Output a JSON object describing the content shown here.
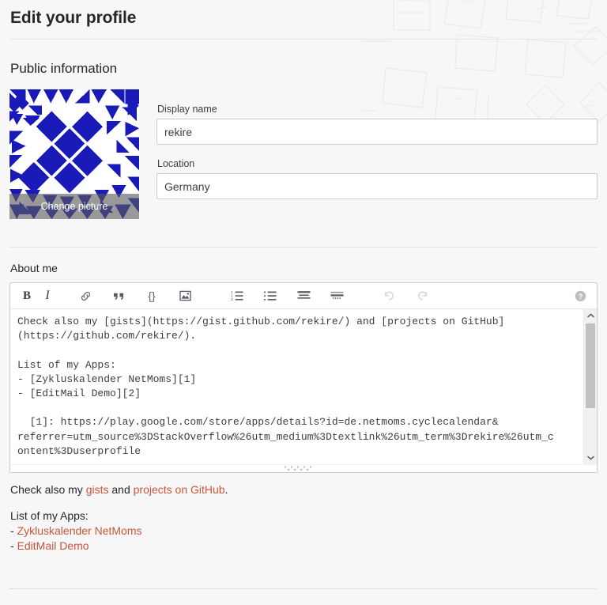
{
  "page": {
    "title": "Edit your profile",
    "section_title": "Public information"
  },
  "avatar": {
    "name": "identicon-avatar",
    "change_label": "Change picture",
    "color": "#1a1ab8",
    "background": "#ffffff"
  },
  "fields": {
    "display_name": {
      "label": "Display name",
      "value": "rekire",
      "placeholder": "Display name"
    },
    "location": {
      "label": "Location",
      "value": "Germany",
      "placeholder": "Location"
    }
  },
  "about": {
    "label": "About me",
    "toolbar": [
      {
        "name": "bold-icon",
        "label": "B",
        "title": "Bold",
        "state": "enabled"
      },
      {
        "name": "italic-icon",
        "label": "I",
        "title": "Italic",
        "state": "enabled"
      },
      {
        "name": "link-icon",
        "label": "",
        "title": "Hyperlink",
        "state": "enabled"
      },
      {
        "name": "quote-icon",
        "label": "“",
        "title": "Blockquote",
        "state": "enabled"
      },
      {
        "name": "code-icon",
        "label": "{}",
        "title": "Code Sample",
        "state": "enabled"
      },
      {
        "name": "image-icon",
        "label": "",
        "title": "Image",
        "state": "enabled"
      },
      {
        "name": "ordered-list-icon",
        "label": "",
        "title": "Numbered List",
        "state": "enabled"
      },
      {
        "name": "bulleted-list-icon",
        "label": "",
        "title": "Bulleted List",
        "state": "enabled"
      },
      {
        "name": "heading-icon",
        "label": "",
        "title": "Heading",
        "state": "enabled"
      },
      {
        "name": "horizontal-rule-icon",
        "label": "",
        "title": "Horizontal Rule",
        "state": "enabled"
      },
      {
        "name": "undo-icon",
        "label": "",
        "title": "Undo",
        "state": "disabled"
      },
      {
        "name": "redo-icon",
        "label": "",
        "title": "Redo",
        "state": "disabled"
      },
      {
        "name": "help-icon",
        "label": "?",
        "title": "Help",
        "state": "enabled"
      }
    ],
    "textarea_value": "Check also my [gists](https://gist.github.com/rekire/) and [projects on GitHub]\n(https://github.com/rekire/).\n\nList of my Apps:\n- [Zykluskalender NetMoms][1]\n- [EditMail Demo][2]\n\n  [1]: https://play.google.com/store/apps/details?id=de.netmoms.cyclecalendar&\nreferrer=utm_source%3DStackOverflow%26utm_medium%3Dtextlink%26utm_term%3Drekire%26utm_c\nontent%3Duserprofile",
    "textarea_placeholder": ""
  },
  "preview": {
    "line1_prefix": "Check also my ",
    "link_gists": "gists",
    "line1_mid": " and ",
    "link_projects": "projects on GitHub",
    "line1_suffix": ".",
    "apps_heading": "List of my Apps:",
    "apps": [
      {
        "dash": "- ",
        "label": "Zykluskalender NetMoms"
      },
      {
        "dash": "- ",
        "label": "EditMail Demo"
      }
    ],
    "link_color": "#c75638"
  }
}
